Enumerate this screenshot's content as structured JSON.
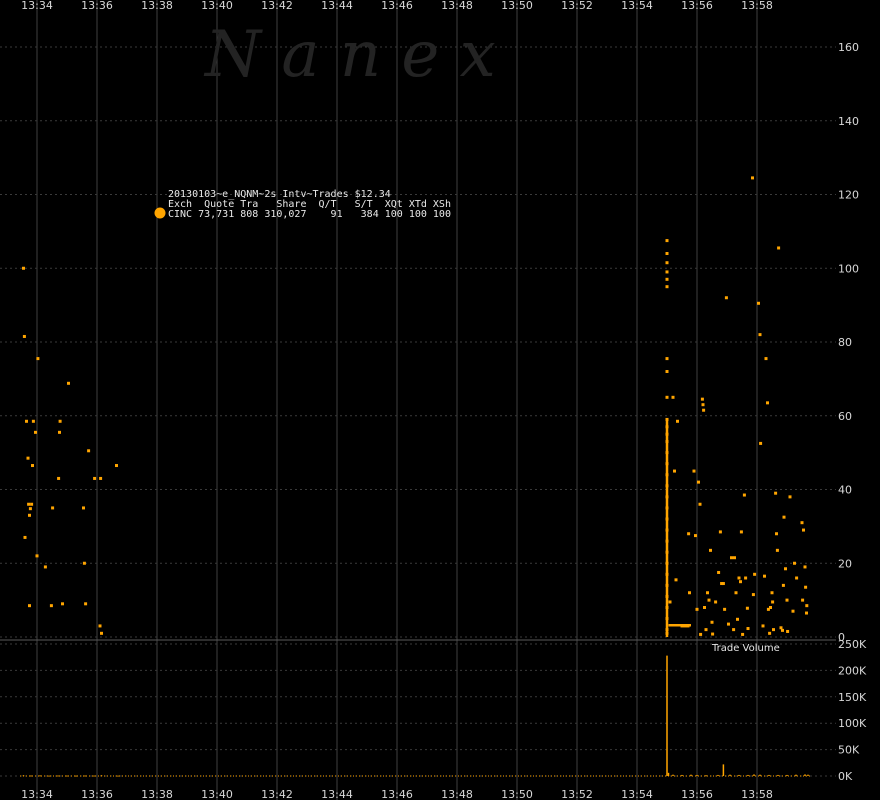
{
  "watermark": "N a n e x",
  "legend": {
    "title": "20130103~e_NQNM~2s Intv~Trades $12.34",
    "header": "Exch  Quote Tra   Share  Q/T   S/T  XQt XTd XSh",
    "row": "CINC 73,731 808 310,027    91   384 100 100 100",
    "marker_color": "#ffa500"
  },
  "volume_label": "Trade Volume",
  "chart_data": {
    "type": "scatter",
    "x_unit": "minute",
    "x_ticks": [
      "13:34",
      "13:36",
      "13:38",
      "13:40",
      "13:42",
      "13:44",
      "13:46",
      "13:48",
      "13:50",
      "13:52",
      "13:54",
      "13:56",
      "13:58"
    ],
    "xlim": [
      "13:33.5",
      "14:00.1"
    ],
    "color": "#ffa500",
    "price_panel": {
      "ylim": [
        0,
        160
      ],
      "y_ticks": [
        "0",
        "20",
        "40",
        "60",
        "80",
        "100",
        "120",
        "140",
        "160"
      ],
      "grid": true,
      "points": [
        [
          33.55,
          100
        ],
        [
          33.58,
          81.5
        ],
        [
          33.6,
          27
        ],
        [
          33.65,
          58.5
        ],
        [
          33.7,
          48.5
        ],
        [
          33.72,
          36
        ],
        [
          33.75,
          33
        ],
        [
          33.75,
          8.5
        ],
        [
          33.78,
          34.8
        ],
        [
          33.82,
          36
        ],
        [
          33.85,
          46.5
        ],
        [
          33.88,
          58.5
        ],
        [
          33.95,
          55.5
        ],
        [
          34.0,
          22
        ],
        [
          34.03,
          75.5
        ],
        [
          34.28,
          19
        ],
        [
          34.48,
          8.5
        ],
        [
          34.52,
          35
        ],
        [
          34.72,
          43
        ],
        [
          34.75,
          55.5
        ],
        [
          34.77,
          58.5
        ],
        [
          34.85,
          9
        ],
        [
          35.05,
          68.8
        ],
        [
          35.55,
          35
        ],
        [
          35.58,
          20
        ],
        [
          35.62,
          9
        ],
        [
          35.72,
          50.5
        ],
        [
          35.92,
          43
        ],
        [
          36.1,
          3
        ],
        [
          36.12,
          43
        ],
        [
          36.15,
          1
        ],
        [
          36.65,
          46.5
        ],
        [
          55.0,
          107.5
        ],
        [
          55.0,
          104
        ],
        [
          55.0,
          101.5
        ],
        [
          55.0,
          99
        ],
        [
          55.0,
          97
        ],
        [
          55.0,
          95
        ],
        [
          55.0,
          75.5
        ],
        [
          55.0,
          72
        ],
        [
          55.0,
          65
        ],
        [
          55.0,
          59
        ],
        [
          55.0,
          57
        ],
        [
          55.0,
          55
        ],
        [
          55.0,
          53
        ],
        [
          55.0,
          50
        ],
        [
          55.0,
          47
        ],
        [
          55.0,
          44
        ],
        [
          55.0,
          41
        ],
        [
          55.0,
          38
        ],
        [
          55.0,
          35
        ],
        [
          55.0,
          32
        ],
        [
          55.0,
          29
        ],
        [
          55.0,
          26
        ],
        [
          55.0,
          23
        ],
        [
          55.0,
          20
        ],
        [
          55.0,
          17
        ],
        [
          55.0,
          14
        ],
        [
          55.0,
          11
        ],
        [
          55.0,
          8
        ],
        [
          55.0,
          5
        ],
        [
          55.0,
          2
        ],
        [
          55.0,
          1
        ],
        [
          55.1,
          9.5
        ],
        [
          55.2,
          65
        ],
        [
          55.25,
          45
        ],
        [
          55.3,
          15.5
        ],
        [
          55.35,
          58.5
        ],
        [
          55.5,
          3
        ],
        [
          55.6,
          3
        ],
        [
          55.7,
          3
        ],
        [
          55.72,
          28
        ],
        [
          55.75,
          12
        ],
        [
          55.9,
          45
        ],
        [
          55.95,
          27.5
        ],
        [
          56.0,
          7.5
        ],
        [
          56.05,
          42
        ],
        [
          56.1,
          36
        ],
        [
          56.12,
          0.7
        ],
        [
          56.18,
          64.5
        ],
        [
          56.2,
          63
        ],
        [
          56.22,
          61.5
        ],
        [
          56.25,
          8
        ],
        [
          56.3,
          2
        ],
        [
          56.35,
          12
        ],
        [
          56.4,
          10
        ],
        [
          56.45,
          23.5
        ],
        [
          56.5,
          4
        ],
        [
          56.52,
          0.8
        ],
        [
          56.62,
          9.5
        ],
        [
          56.72,
          17.5
        ],
        [
          56.78,
          28.5
        ],
        [
          56.82,
          14.5
        ],
        [
          56.88,
          14.5
        ],
        [
          56.92,
          7.5
        ],
        [
          56.98,
          92
        ],
        [
          57.05,
          3.5
        ],
        [
          57.15,
          21.5
        ],
        [
          57.22,
          2
        ],
        [
          57.25,
          21.5
        ],
        [
          57.3,
          12
        ],
        [
          57.35,
          4.8
        ],
        [
          57.4,
          16
        ],
        [
          57.45,
          15
        ],
        [
          57.48,
          28.5
        ],
        [
          57.52,
          0.7
        ],
        [
          57.58,
          38.5
        ],
        [
          57.62,
          16
        ],
        [
          57.68,
          7.8
        ],
        [
          57.7,
          2.3
        ],
        [
          57.85,
          124.5
        ],
        [
          57.88,
          11.5
        ],
        [
          57.92,
          17
        ],
        [
          58.05,
          90.5
        ],
        [
          58.1,
          82
        ],
        [
          58.12,
          52.5
        ],
        [
          58.2,
          3
        ],
        [
          58.25,
          16.5
        ],
        [
          58.3,
          75.5
        ],
        [
          58.35,
          63.5
        ],
        [
          58.38,
          7.5
        ],
        [
          58.42,
          1
        ],
        [
          58.45,
          8
        ],
        [
          58.5,
          12
        ],
        [
          58.52,
          9.5
        ],
        [
          58.55,
          2
        ],
        [
          58.62,
          39
        ],
        [
          58.65,
          28
        ],
        [
          58.68,
          23.5
        ],
        [
          58.72,
          105.5
        ],
        [
          58.8,
          2.5
        ],
        [
          58.85,
          1.8
        ],
        [
          58.88,
          14
        ],
        [
          58.9,
          32.5
        ],
        [
          58.95,
          18.5
        ],
        [
          59.0,
          10
        ],
        [
          59.02,
          1.5
        ],
        [
          59.1,
          38
        ],
        [
          59.2,
          7
        ],
        [
          59.25,
          20
        ],
        [
          59.32,
          16
        ],
        [
          59.5,
          31
        ],
        [
          59.52,
          10
        ],
        [
          59.55,
          29
        ],
        [
          59.6,
          19
        ],
        [
          59.62,
          13.5
        ],
        [
          59.65,
          6.5
        ],
        [
          59.66,
          8.5
        ]
      ],
      "segments": [
        [
          55.05,
          3.2,
          55.8,
          3.2
        ],
        [
          55.0,
          0,
          55.0,
          59
        ]
      ]
    },
    "volume_panel": {
      "label": "Trade Volume",
      "ylim": [
        0,
        250000
      ],
      "y_ticks": [
        "0K",
        "50K",
        "100K",
        "150K",
        "200K",
        "250K"
      ],
      "bars": [
        [
          33.55,
          1500
        ],
        [
          33.8,
          1000
        ],
        [
          34.1,
          1200
        ],
        [
          34.4,
          800
        ],
        [
          34.7,
          1000
        ],
        [
          35.0,
          900
        ],
        [
          35.3,
          800
        ],
        [
          35.6,
          1000
        ],
        [
          35.9,
          900
        ],
        [
          36.15,
          1500
        ],
        [
          36.7,
          800
        ],
        [
          55.0,
          228000
        ],
        [
          55.05,
          6000
        ],
        [
          55.2,
          2500
        ],
        [
          55.5,
          2000
        ],
        [
          55.8,
          2500
        ],
        [
          56.0,
          2000
        ],
        [
          56.3,
          1500
        ],
        [
          56.7,
          2000
        ],
        [
          56.88,
          22000
        ],
        [
          57.1,
          2500
        ],
        [
          57.4,
          2000
        ],
        [
          57.7,
          2000
        ],
        [
          57.9,
          3000
        ],
        [
          58.1,
          2500
        ],
        [
          58.4,
          2000
        ],
        [
          58.7,
          2000
        ],
        [
          59.0,
          2000
        ],
        [
          59.3,
          2500
        ],
        [
          59.6,
          3000
        ],
        [
          59.7,
          2500
        ]
      ]
    }
  }
}
